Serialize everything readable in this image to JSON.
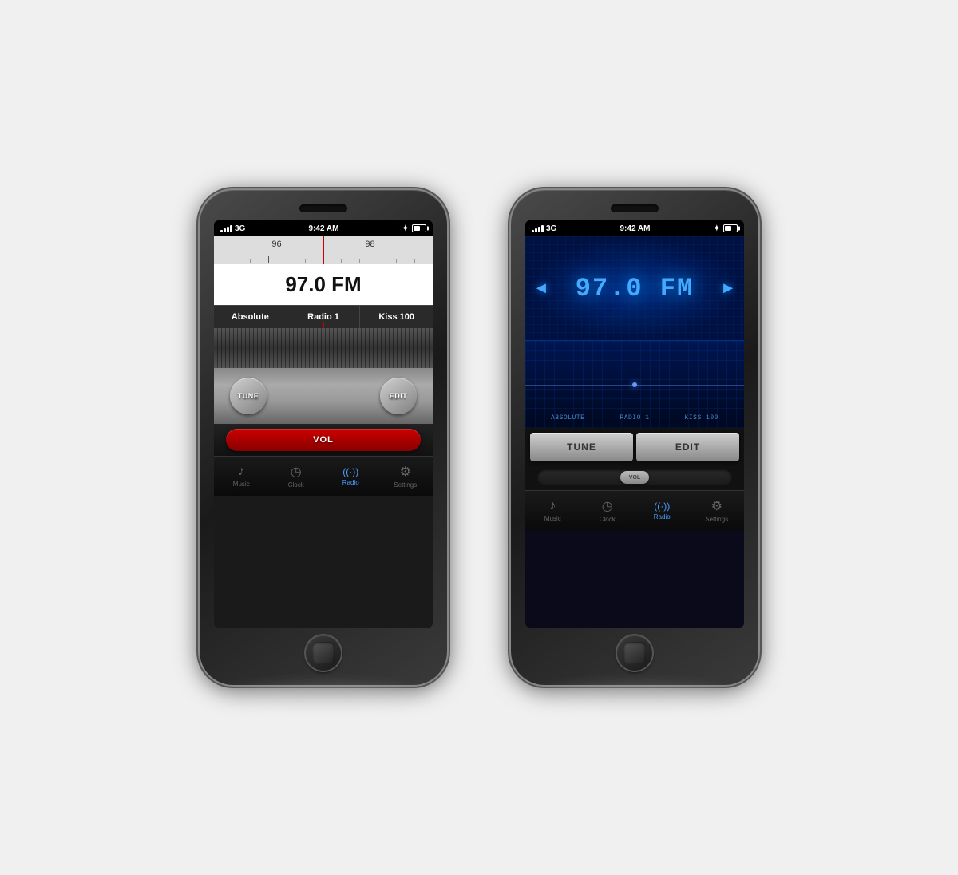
{
  "page": {
    "background_color": "#f0f0f0"
  },
  "left_phone": {
    "status": {
      "signal": "3G",
      "time": "9:42 AM",
      "bluetooth": true,
      "battery": true
    },
    "tuner": {
      "scale_numbers": [
        "96",
        "98"
      ],
      "frequency": "97.0 FM"
    },
    "presets": [
      {
        "label": "Absolute"
      },
      {
        "label": "Radio 1"
      },
      {
        "label": "Kiss 100"
      }
    ],
    "controls": {
      "tune_label": "TUNE",
      "edit_label": "EDIT",
      "vol_label": "VOL"
    },
    "tabs": [
      {
        "label": "Music",
        "icon": "♪",
        "active": false
      },
      {
        "label": "Clock",
        "icon": "◷",
        "active": false
      },
      {
        "label": "Radio",
        "icon": "((·))",
        "active": true
      },
      {
        "label": "Settings",
        "icon": "⚙",
        "active": false
      }
    ]
  },
  "right_phone": {
    "status": {
      "signal": "3G",
      "time": "9:42 AM",
      "bluetooth": true,
      "battery": true
    },
    "display": {
      "frequency": "97.0 FM",
      "arrow_left": "◄",
      "arrow_right": "►"
    },
    "presets": [
      {
        "label": "ABSOLUTE"
      },
      {
        "label": "RADIO 1"
      },
      {
        "label": "KISS 100"
      }
    ],
    "controls": {
      "tune_label": "TUNE",
      "edit_label": "EDIT",
      "vol_label": "VOL"
    },
    "tabs": [
      {
        "label": "Music",
        "icon": "♪",
        "active": false
      },
      {
        "label": "Clock",
        "icon": "◷",
        "active": false
      },
      {
        "label": "Radio",
        "icon": "((·))",
        "active": true
      },
      {
        "label": "Settings",
        "icon": "⚙",
        "active": false
      }
    ]
  }
}
